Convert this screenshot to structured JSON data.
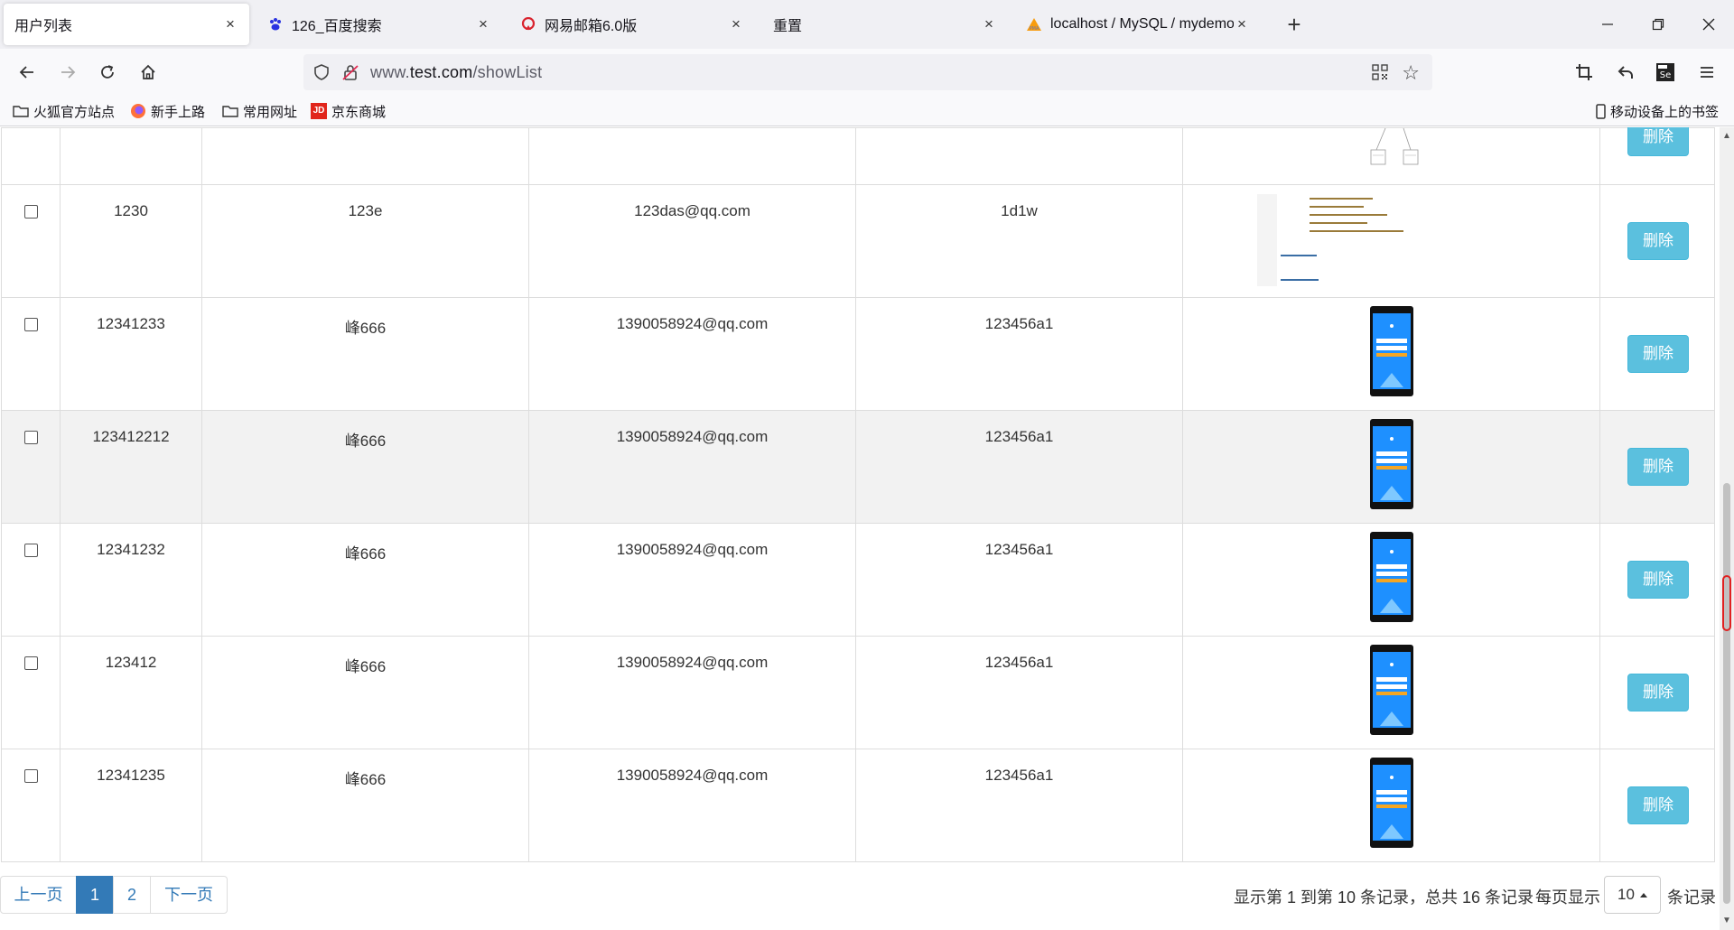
{
  "browser": {
    "tabs": [
      {
        "title": "用户列表",
        "icon": "none"
      },
      {
        "title": "126_百度搜索",
        "icon": "baidu-paw"
      },
      {
        "title": "网易邮箱6.0版",
        "icon": "netease-mail"
      },
      {
        "title": "重置",
        "icon": "none"
      },
      {
        "title": "localhost / MySQL / mydemo",
        "icon": "phpmyadmin"
      }
    ],
    "close_glyph": "×",
    "new_tab_glyph": "+",
    "url": {
      "prefix": "www.",
      "host": "test.com",
      "path": "/showList"
    },
    "bookmarks": [
      {
        "label": "火狐官方站点",
        "icon": "folder"
      },
      {
        "label": "新手上路",
        "icon": "firefox"
      },
      {
        "label": "常用网址",
        "icon": "folder"
      },
      {
        "label": "京东商城",
        "icon": "jd"
      }
    ],
    "jd_badge": "JD",
    "mobile_bookmarks": "移动设备上的书签"
  },
  "table": {
    "delete_label": "删除",
    "rows": [
      {
        "id": "1230",
        "name": "123e",
        "email": "123das@qq.com",
        "password": "1d1w",
        "image": "code-screenshot",
        "highlight": false
      },
      {
        "id": "12341233",
        "name": "峰666",
        "email": "1390058924@qq.com",
        "password": "123456a1",
        "image": "phone-screenshot",
        "highlight": false
      },
      {
        "id": "123412212",
        "name": "峰666",
        "email": "1390058924@qq.com",
        "password": "123456a1",
        "image": "phone-screenshot",
        "highlight": true
      },
      {
        "id": "12341232",
        "name": "峰666",
        "email": "1390058924@qq.com",
        "password": "123456a1",
        "image": "phone-screenshot",
        "highlight": false
      },
      {
        "id": "123412",
        "name": "峰666",
        "email": "1390058924@qq.com",
        "password": "123456a1",
        "image": "phone-screenshot",
        "highlight": false
      },
      {
        "id": "12341235",
        "name": "峰666",
        "email": "1390058924@qq.com",
        "password": "123456a1",
        "image": "phone-screenshot",
        "highlight": false
      }
    ]
  },
  "pagination": {
    "prev": "上一页",
    "pages": [
      "1",
      "2"
    ],
    "active_page": "1",
    "next": "下一页",
    "info": "显示第 1 到第 10 条记录，总共 16 条记录",
    "per_page_prefix": "每页显示",
    "per_page_value": "10",
    "per_page_suffix": "条记录"
  },
  "colors": {
    "delete_button": "#5bc0de",
    "pager_active": "#337ab7",
    "row_hover": "#f2f2f2"
  }
}
